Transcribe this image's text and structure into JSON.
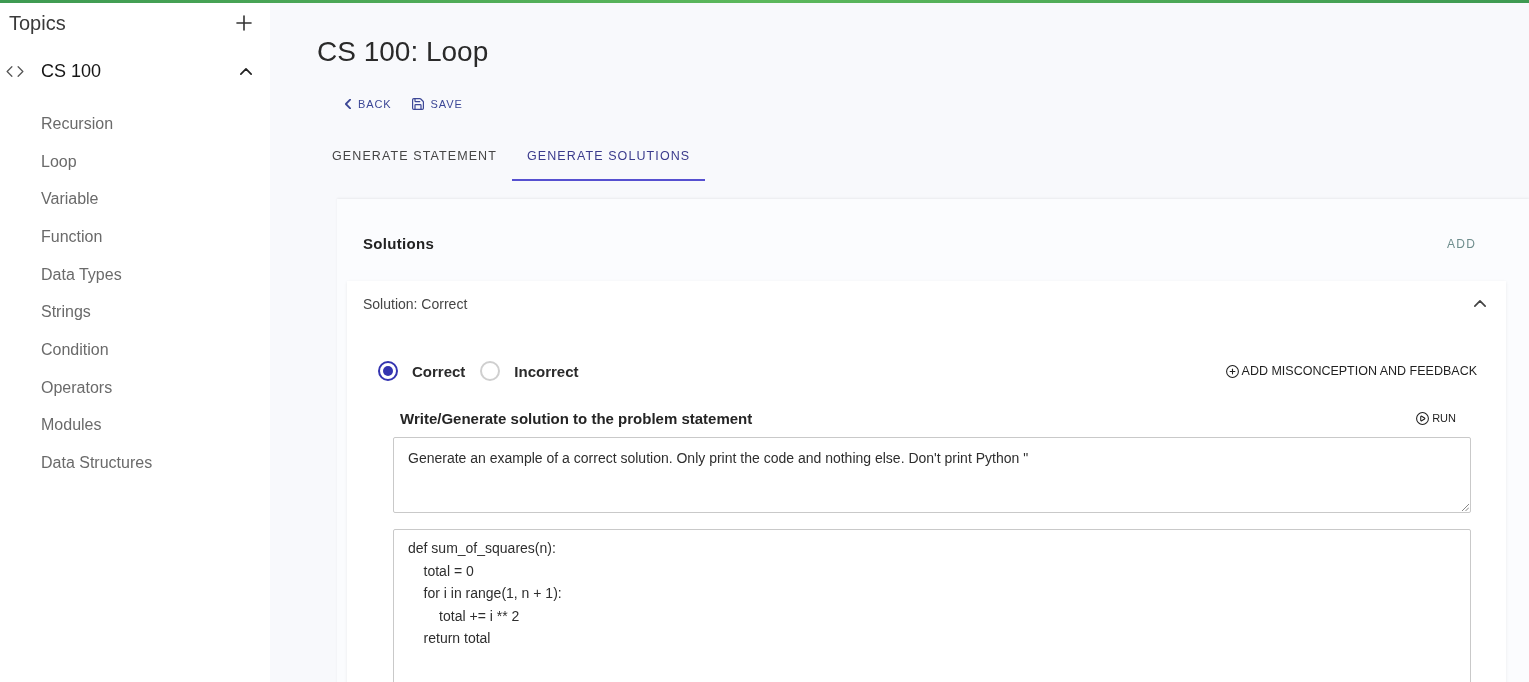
{
  "sidebar": {
    "title": "Topics",
    "groups": [
      {
        "label": "CS 100",
        "expanded": true,
        "children": [
          {
            "label": "Recursion"
          },
          {
            "label": "Loop"
          },
          {
            "label": "Variable"
          },
          {
            "label": "Function"
          },
          {
            "label": "Data Types"
          },
          {
            "label": "Strings"
          },
          {
            "label": "Condition"
          },
          {
            "label": "Operators"
          },
          {
            "label": "Modules"
          },
          {
            "label": "Data Structures"
          }
        ]
      }
    ]
  },
  "page": {
    "title": "CS 100: Loop",
    "actions": [
      {
        "kind": "back",
        "label": "BACK"
      },
      {
        "kind": "save",
        "label": "SAVE"
      }
    ]
  },
  "tabs": [
    {
      "label": "GENERATE STATEMENT",
      "selected": false
    },
    {
      "label": "GENERATE SOLUTIONS",
      "selected": true
    }
  ],
  "solutions_panel": {
    "title": "Solutions",
    "add_label": "ADD",
    "items": [
      {
        "title": "Solution: Correct",
        "expanded": true,
        "options": [
          {
            "label": "Correct",
            "selected": true
          },
          {
            "label": "Incorrect",
            "selected": false
          }
        ],
        "misconception_button": "ADD MISCONCEPTION AND FEEDBACK",
        "prompt_label": "Write/Generate solution to the problem statement",
        "run_label": "RUN",
        "prompt": "Generate an example of a correct solution. Only print the code and nothing else. Don't print Python \"",
        "code": [
          "def sum_of_squares(n):",
          "    total = 0",
          "    for i in range(1, n + 1):",
          "        total += i ** 2",
          "    return total"
        ]
      }
    ]
  }
}
